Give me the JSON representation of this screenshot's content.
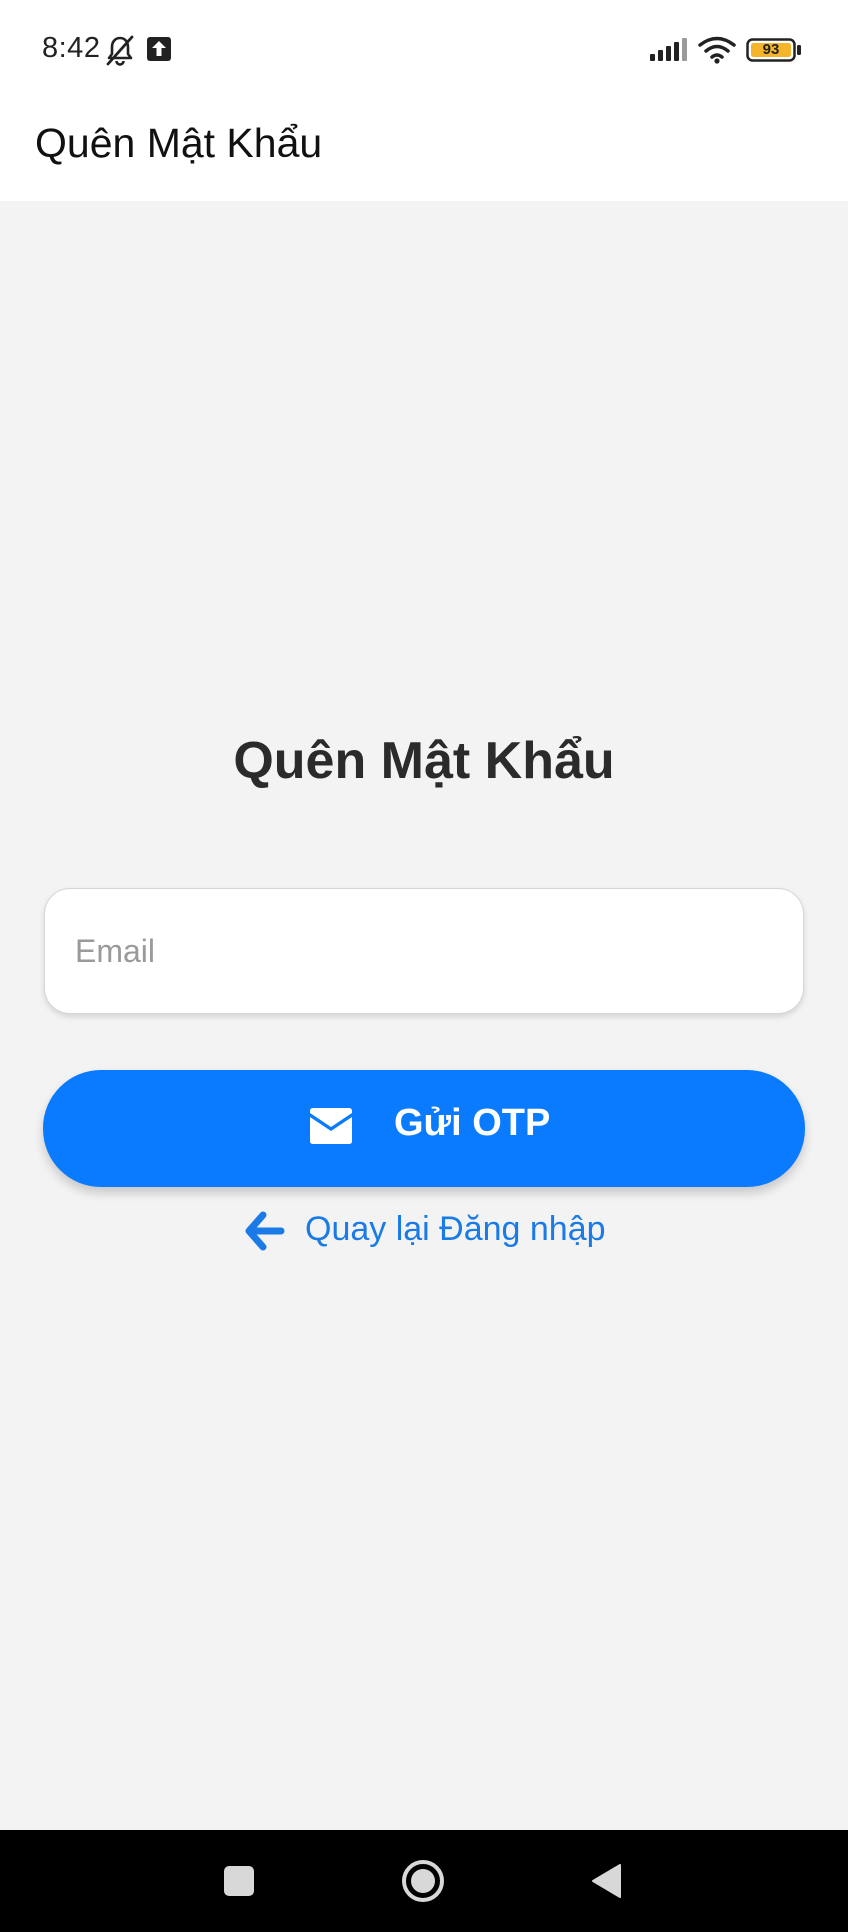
{
  "status_bar": {
    "time": "8:42",
    "battery_level": "93",
    "icons": [
      "bell-off-icon",
      "upload-icon",
      "signal-icon",
      "wifi-icon",
      "battery-icon"
    ]
  },
  "header": {
    "title": "Quên Mật Khẩu"
  },
  "main": {
    "title": "Quên Mật Khẩu",
    "email": {
      "value": "",
      "placeholder": "Email"
    },
    "send_button": {
      "label": "Gửi OTP",
      "icon": "envelope-icon"
    },
    "back_link": {
      "label": "Quay lại Đăng nhập",
      "icon": "arrow-left-icon"
    }
  },
  "nav_bar": {
    "buttons": [
      "recents-square-icon",
      "home-circle-icon",
      "back-triangle-icon"
    ]
  },
  "colors": {
    "primary": "#0a7bff",
    "link": "#1a7be6",
    "background": "#f3f3f3",
    "battery_fill": "#f4b52a"
  }
}
